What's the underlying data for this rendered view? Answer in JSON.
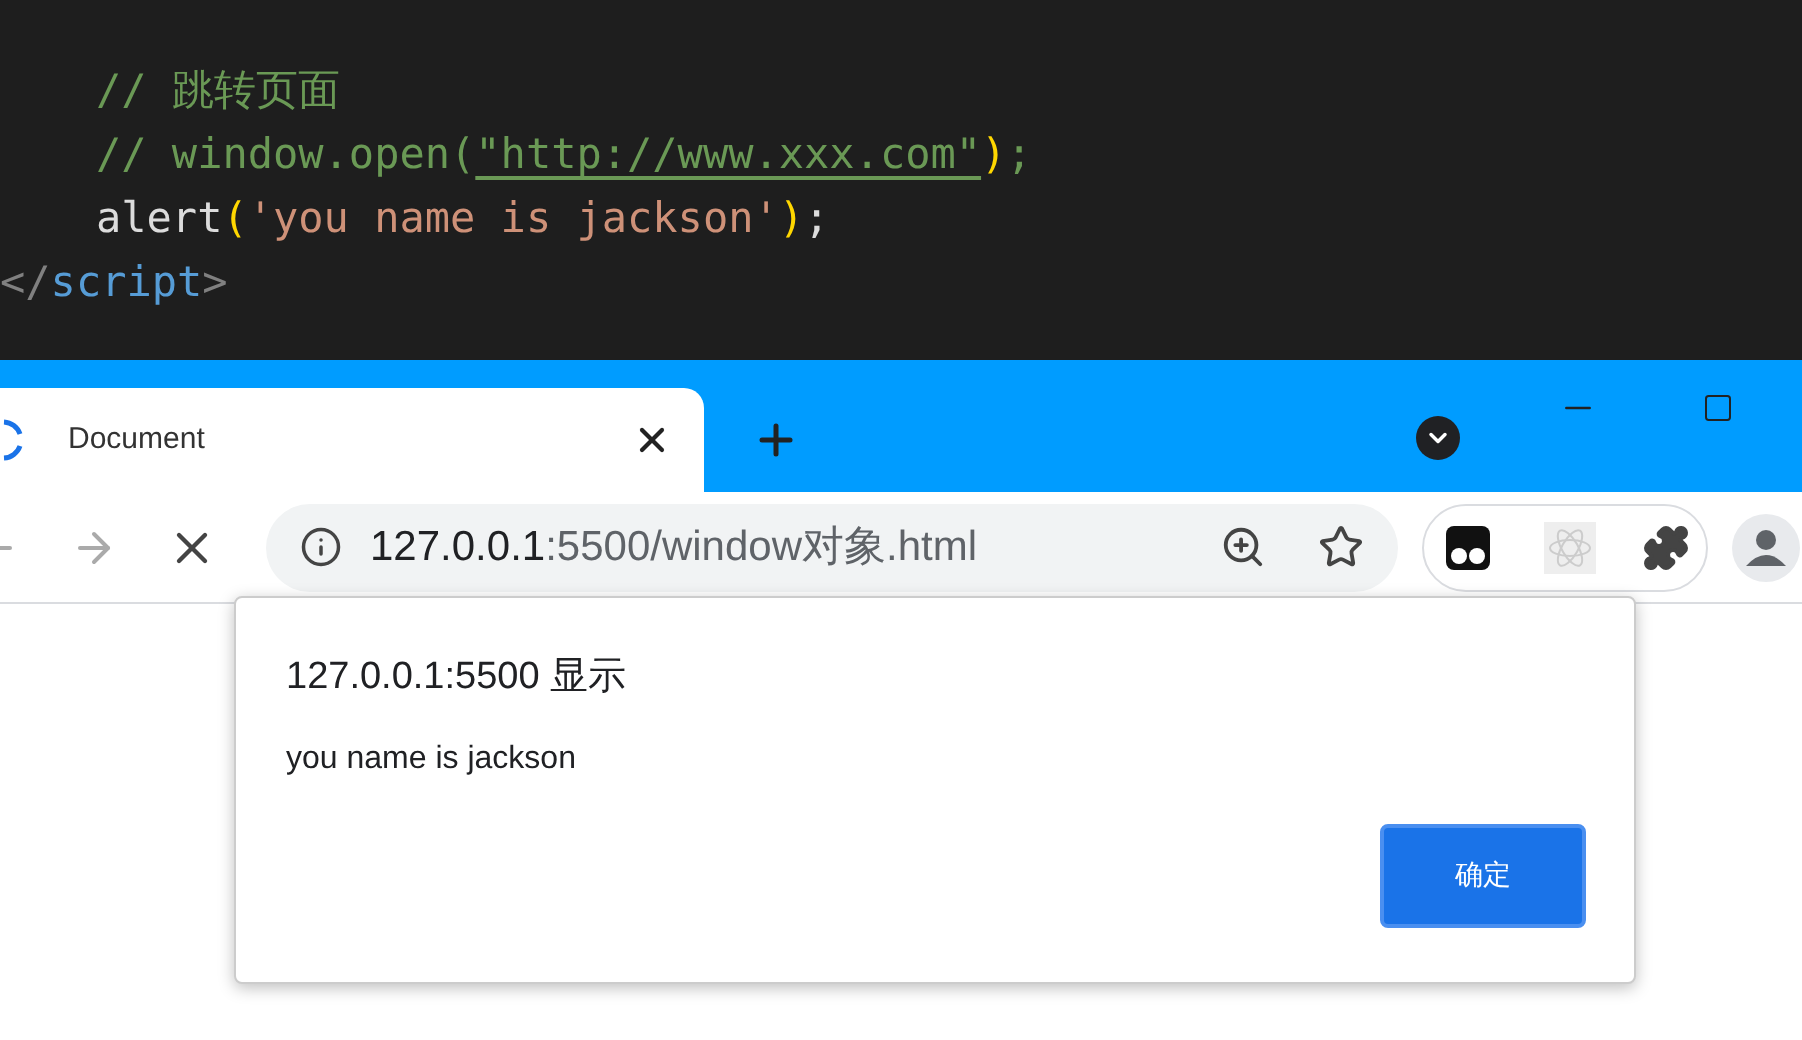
{
  "code_lines": [
    {
      "indent": true,
      "tokens": [
        {
          "kind": "comment",
          "text": "// 跳转页面"
        }
      ]
    },
    {
      "indent": true,
      "tokens": [
        {
          "kind": "comment",
          "text": "// window.open("
        },
        {
          "kind": "link",
          "text": "\"http://www.xxx.com\""
        },
        {
          "kind": "paren",
          "text": ")"
        },
        {
          "kind": "comment",
          "text": ";"
        }
      ]
    },
    {
      "indent": true,
      "tokens": [
        {
          "kind": "plain",
          "text": "alert"
        },
        {
          "kind": "paren",
          "text": "("
        },
        {
          "kind": "string",
          "text": "'you name is jackson'"
        },
        {
          "kind": "paren",
          "text": ")"
        },
        {
          "kind": "plain",
          "text": ";"
        }
      ]
    },
    {
      "indent": false,
      "tokens": [
        {
          "kind": "bracket",
          "text": "</"
        },
        {
          "kind": "tag",
          "text": "script"
        },
        {
          "kind": "bracket",
          "text": ">"
        }
      ]
    }
  ],
  "tab": {
    "title": "Document",
    "selected": true
  },
  "address": {
    "host": "127.0.0.1",
    "path": ":5500/window对象.html"
  },
  "dialog": {
    "title": "127.0.0.1:5500 显示",
    "message": "you name is jackson",
    "button": "确定"
  }
}
